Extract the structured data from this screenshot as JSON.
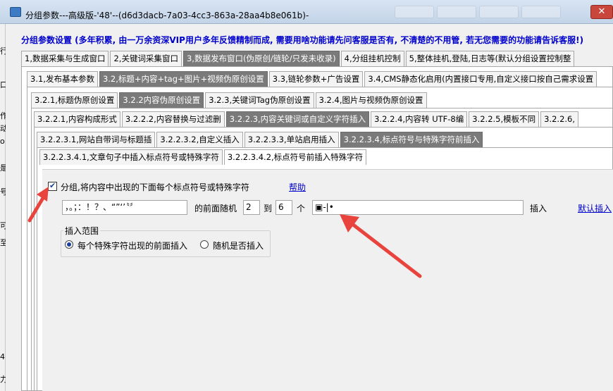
{
  "window": {
    "title": "分组参数---高级版-'48'--(d6d3dacb-7a03-4cc3-863a-28aa4b8e061b)-",
    "close_label": "✕"
  },
  "notice": "分组参数设置 (多年积累, 由一万余资深VIP用户多年反馈精制而成, 需要用啥功能请先问客服是否有, 不清楚的不用管, 若无您需要的功能请告诉客服!)",
  "tabs_level1": [
    "1,数据采集与生成窗口",
    "2,关键词采集窗口",
    "3,数据发布窗口(伪原创/链轮/只发未收录)",
    "4,分组挂机控制",
    "5,整体挂机,登陆,日志等(默认分组设置控制整"
  ],
  "tabs_level2": [
    "3.1,发布基本参数",
    "3.2,标题+内容+tag+图片+视频伪原创设置",
    "3.3,链轮参数+广告设置",
    "3.4,CMS静态化启用(内置接口专用,自定义接口按自己需求设置"
  ],
  "tabs_level3": [
    "3.2.1,标题伪原创设置",
    "3.2.2内容伪原创设置",
    "3.2.3,关键词Tag伪原创设置",
    "3.2.4,图片与视频伪原创设置"
  ],
  "tabs_level4": [
    "3.2.2.1,内容构成形式",
    "3.2.2.2,内容替换与过滤删",
    "3.2.2.3,内容关键词或自定义字符插入",
    "3.2.2.4,内容转 UTF-8编",
    "3.2.2.5,模板不同",
    "3.2.2.6,"
  ],
  "tabs_level5": [
    "3.2.2.3.1,网站自带词与标题插",
    "3.2.2.3.2,自定义插入",
    "3.2.2.3.3,单站启用插入",
    "3.2.2.3.4,标点符号与特殊字符前插入"
  ],
  "tabs_level6": [
    "3.2.2.3.4.1,文章句子中插入标点符号或特殊字符",
    "3.2.2.3.4.2,标点符号前插入特殊字符"
  ],
  "form": {
    "enable_checkbox_label": "分组,将内容中出现的下面每个标点符号或特殊字符",
    "help_link": "帮助",
    "punctuation_value": "，。；：！？、“”‘’〝〞",
    "before_random_label": "的前面随机",
    "min_count": "2",
    "to_label": "到",
    "max_count": "6",
    "unit_label": "个",
    "special_chars_value": "▣-|•",
    "insert_label": "插入",
    "default_insert_link": "默认插入",
    "range_group_title": "插入范围",
    "radio_each": "每个特殊字符出现的前面插入",
    "radio_random": "随机是否插入"
  },
  "left_strip_chars": [
    "行",
    "口",
    "作",
    "动",
    "o",
    "是",
    "号",
    "可",
    "至",
    "4",
    "力"
  ],
  "colors": {
    "notice_text": "#0000cc",
    "active_tab": "#7a7a7a",
    "arrow": "#e8433c",
    "close_button": "#c9463d"
  }
}
